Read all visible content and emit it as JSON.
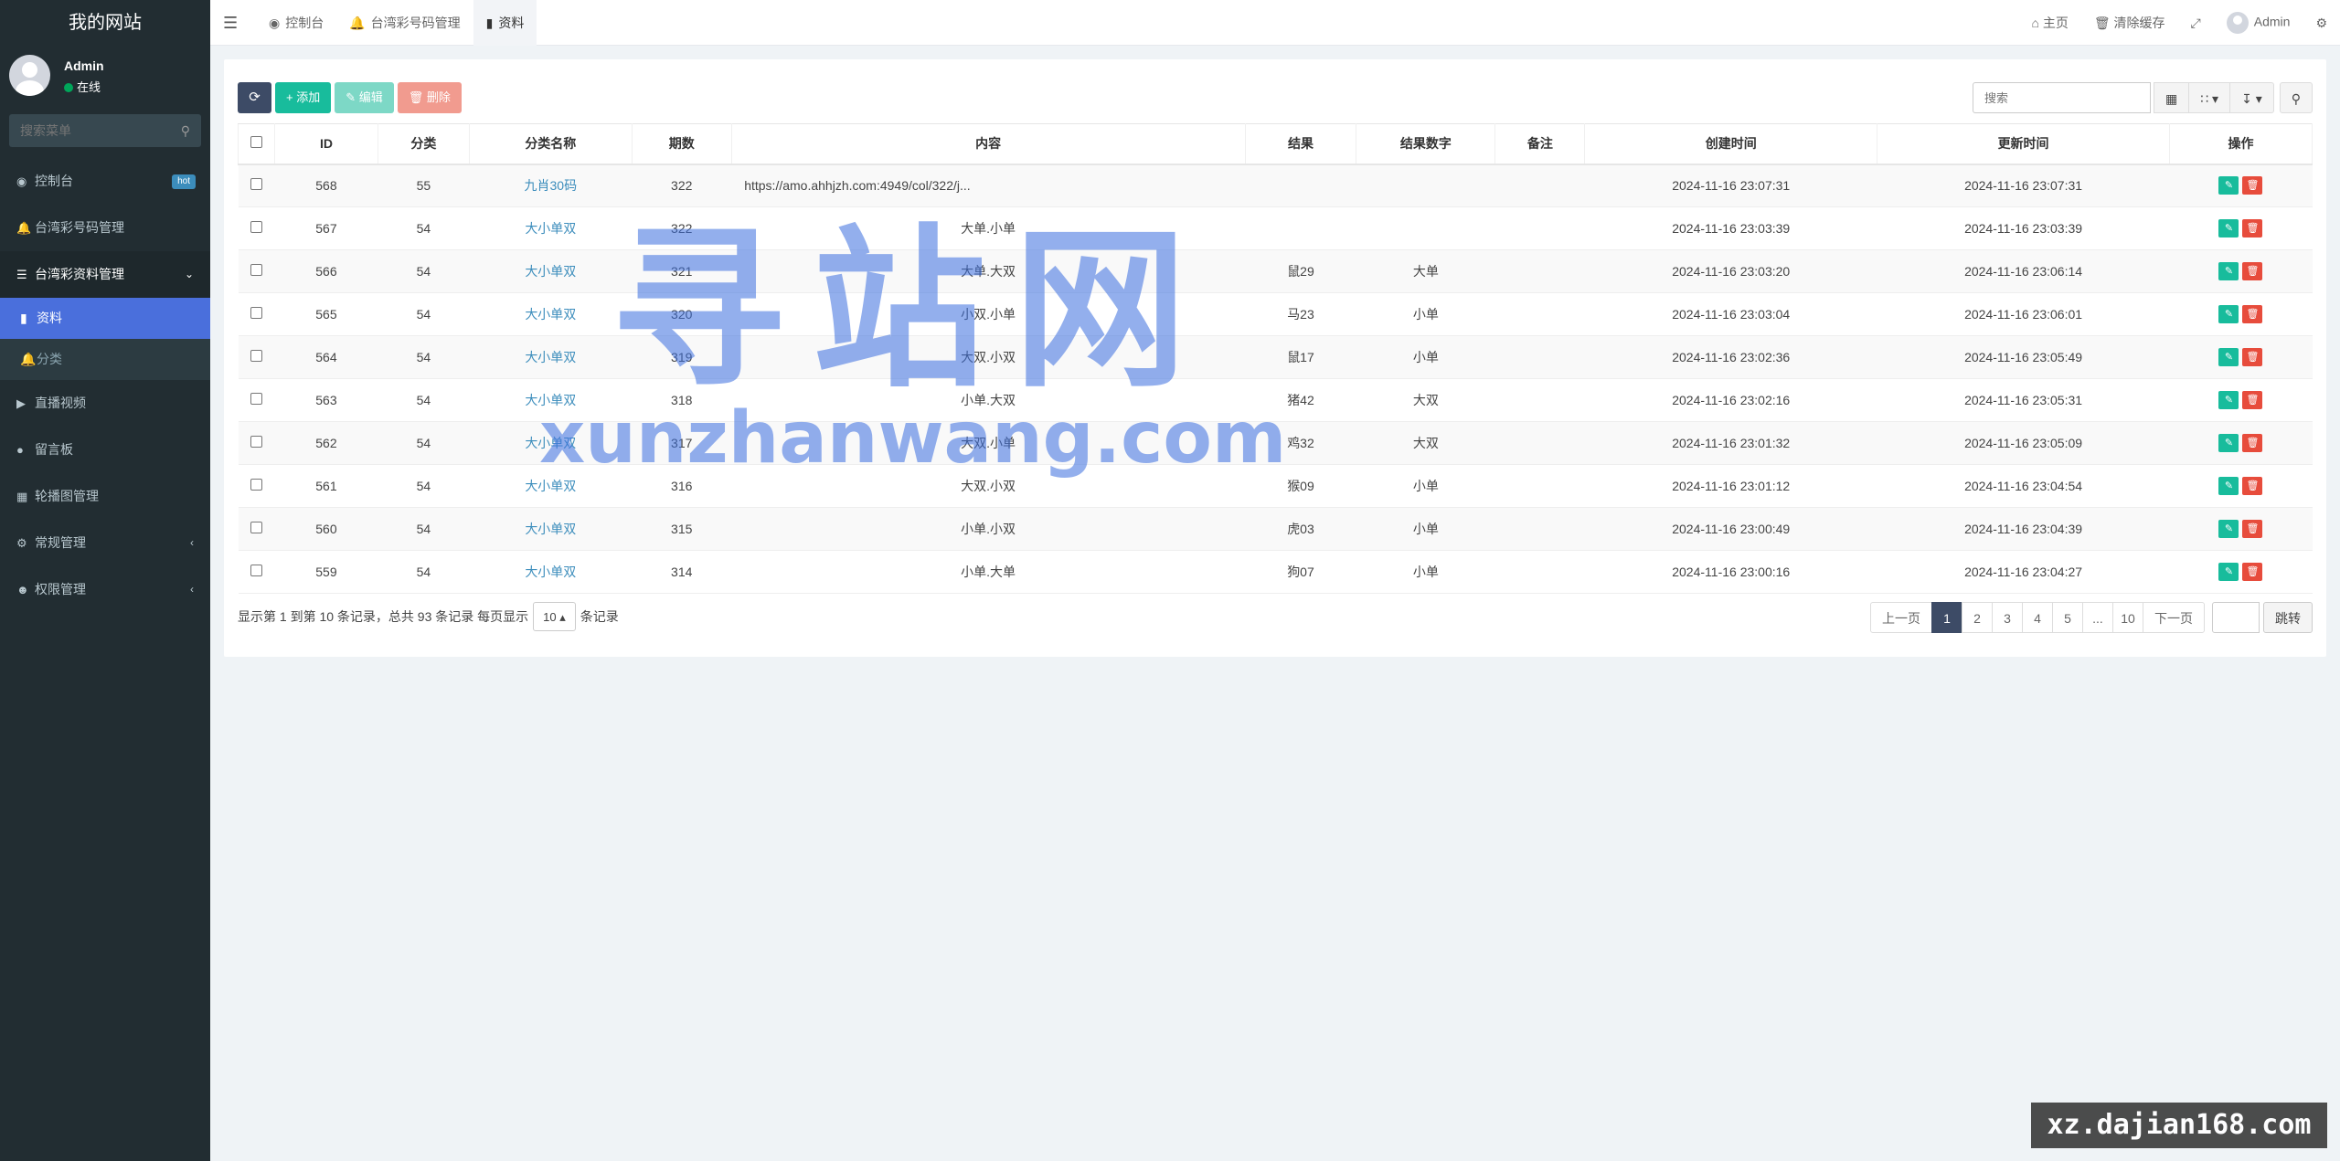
{
  "sidebar": {
    "logo": "我的网站",
    "user": {
      "name": "Admin",
      "status": "在线"
    },
    "search_placeholder": "搜索菜单",
    "menu": [
      {
        "label": "控制台",
        "icon": "dashboard-icon",
        "badge": "hot"
      },
      {
        "label": "台湾彩号码管理",
        "icon": "bell-icon"
      },
      {
        "label": "台湾彩资料管理",
        "icon": "list-icon"
      },
      {
        "label": "直播视频",
        "icon": "video-icon"
      },
      {
        "label": "留言板",
        "icon": "comment-icon"
      },
      {
        "label": "轮播图管理",
        "icon": "image-icon"
      },
      {
        "label": "常规管理",
        "icon": "gears-icon"
      },
      {
        "label": "权限管理",
        "icon": "users-icon"
      }
    ],
    "submenu": [
      {
        "label": "资料",
        "icon": "bookmark-icon"
      },
      {
        "label": "分类",
        "icon": "bell-icon"
      }
    ]
  },
  "topbar": {
    "tabs": [
      {
        "label": "控制台",
        "icon": "dashboard-icon"
      },
      {
        "label": "台湾彩号码管理",
        "icon": "bell-icon"
      },
      {
        "label": "资料",
        "icon": "bookmark-icon"
      }
    ],
    "home": "主页",
    "clear_cache": "清除缓存",
    "admin": "Admin"
  },
  "toolbar": {
    "add": "添加",
    "edit": "编辑",
    "delete": "删除",
    "search_placeholder": "搜索"
  },
  "table": {
    "headers": [
      "ID",
      "分类",
      "分类名称",
      "期数",
      "内容",
      "结果",
      "结果数字",
      "备注",
      "创建时间",
      "更新时间",
      "操作"
    ],
    "rows": [
      {
        "id": "568",
        "cat": "55",
        "cat_name": "九肖30码",
        "period": "322",
        "content": "https://amo.ahhjzh.com:4949/col/322/j...",
        "result": "",
        "result_num": "",
        "note": "",
        "created": "2024-11-16 23:07:31",
        "updated": "2024-11-16 23:07:31"
      },
      {
        "id": "567",
        "cat": "54",
        "cat_name": "大小单双",
        "period": "322",
        "content": "大单.小单",
        "result": "",
        "result_num": "",
        "note": "",
        "created": "2024-11-16 23:03:39",
        "updated": "2024-11-16 23:03:39"
      },
      {
        "id": "566",
        "cat": "54",
        "cat_name": "大小单双",
        "period": "321",
        "content": "大单.大双",
        "result": "鼠29",
        "result_num": "大单",
        "note": "",
        "created": "2024-11-16 23:03:20",
        "updated": "2024-11-16 23:06:14"
      },
      {
        "id": "565",
        "cat": "54",
        "cat_name": "大小单双",
        "period": "320",
        "content": "小双.小单",
        "result": "马23",
        "result_num": "小单",
        "note": "",
        "created": "2024-11-16 23:03:04",
        "updated": "2024-11-16 23:06:01"
      },
      {
        "id": "564",
        "cat": "54",
        "cat_name": "大小单双",
        "period": "319",
        "content": "大双.小双",
        "result": "鼠17",
        "result_num": "小单",
        "note": "",
        "created": "2024-11-16 23:02:36",
        "updated": "2024-11-16 23:05:49"
      },
      {
        "id": "563",
        "cat": "54",
        "cat_name": "大小单双",
        "period": "318",
        "content": "小单.大双",
        "result": "猪42",
        "result_num": "大双",
        "note": "",
        "created": "2024-11-16 23:02:16",
        "updated": "2024-11-16 23:05:31"
      },
      {
        "id": "562",
        "cat": "54",
        "cat_name": "大小单双",
        "period": "317",
        "content": "大双.小单",
        "result": "鸡32",
        "result_num": "大双",
        "note": "",
        "created": "2024-11-16 23:01:32",
        "updated": "2024-11-16 23:05:09"
      },
      {
        "id": "561",
        "cat": "54",
        "cat_name": "大小单双",
        "period": "316",
        "content": "大双.小双",
        "result": "猴09",
        "result_num": "小单",
        "note": "",
        "created": "2024-11-16 23:01:12",
        "updated": "2024-11-16 23:04:54"
      },
      {
        "id": "560",
        "cat": "54",
        "cat_name": "大小单双",
        "period": "315",
        "content": "小单.小双",
        "result": "虎03",
        "result_num": "小单",
        "note": "",
        "created": "2024-11-16 23:00:49",
        "updated": "2024-11-16 23:04:39"
      },
      {
        "id": "559",
        "cat": "54",
        "cat_name": "大小单双",
        "period": "314",
        "content": "小单.大单",
        "result": "狗07",
        "result_num": "小单",
        "note": "",
        "created": "2024-11-16 23:00:16",
        "updated": "2024-11-16 23:04:27"
      }
    ]
  },
  "pagination": {
    "info_prefix": "显示第 1 到第 10 条记录，总共 93 条记录 每页显示",
    "page_size": "10",
    "info_suffix": "条记录",
    "prev": "上一页",
    "pages": [
      "1",
      "2",
      "3",
      "4",
      "5",
      "...",
      "10"
    ],
    "next": "下一页",
    "jump": "跳转"
  },
  "watermark": {
    "cn": "寻站网",
    "en": "xunzhanwang.com",
    "corner": "xz.dajian168.com"
  }
}
